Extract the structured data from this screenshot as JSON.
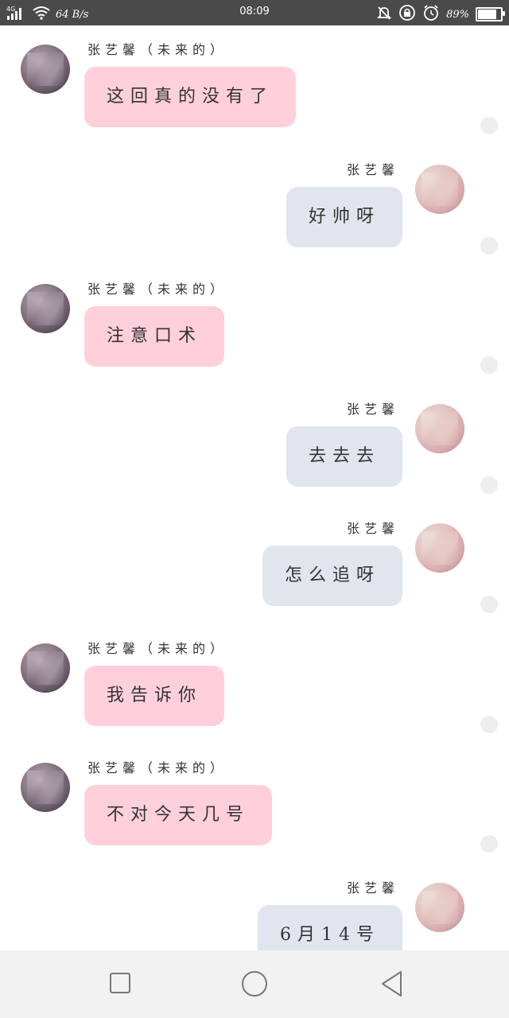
{
  "status_bar": {
    "network": "4G",
    "speed": "64 B/s",
    "time": "08:09",
    "battery": "89%",
    "battery_level": 0.89,
    "icons": [
      "signal-icon",
      "wifi-icon",
      "mute-icon",
      "lock-rotation-icon",
      "alarm-icon",
      "battery-icon"
    ]
  },
  "messages": [
    {
      "side": "left",
      "sender": "张艺馨（未来的）",
      "text": "这回真的没有了"
    },
    {
      "side": "right",
      "sender": "张艺馨",
      "text": "好帅呀"
    },
    {
      "side": "left",
      "sender": "张艺馨（未来的）",
      "text": "注意口术"
    },
    {
      "side": "right",
      "sender": "张艺馨",
      "text": "去去去"
    },
    {
      "side": "right",
      "sender": "张艺馨",
      "text": "怎么追呀"
    },
    {
      "side": "left",
      "sender": "张艺馨（未来的）",
      "text": "我告诉你"
    },
    {
      "side": "left",
      "sender": "张艺馨（未来的）",
      "text": "不对今天几号"
    },
    {
      "side": "right",
      "sender": "张艺馨",
      "text": "6月14号"
    }
  ],
  "nav_bar": {
    "buttons": [
      "recent-apps-icon",
      "home-icon",
      "back-icon"
    ]
  },
  "colors": {
    "left_bubble": "#ffd0dc",
    "right_bubble": "#e1e6ee",
    "status_bar": "#4a4a4a",
    "nav_bar": "#f2f2f2"
  }
}
